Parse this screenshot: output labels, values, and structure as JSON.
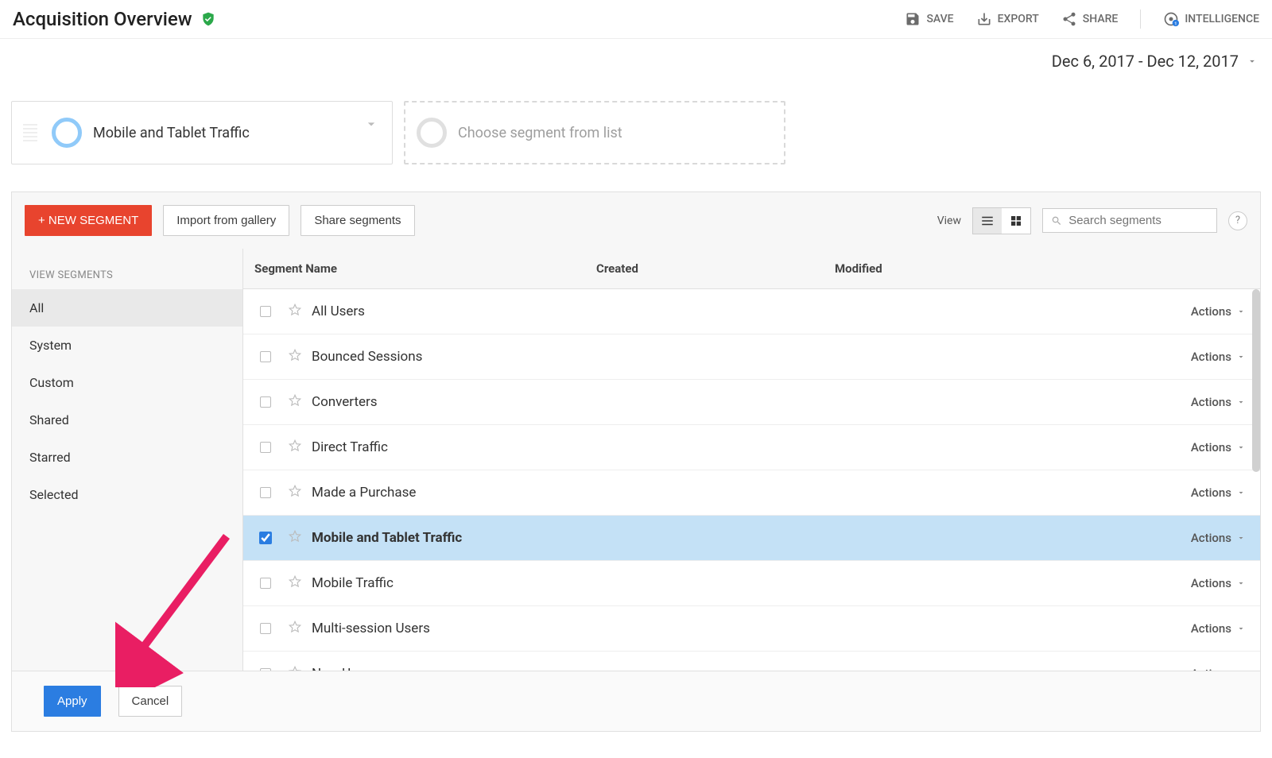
{
  "header": {
    "title": "Acquisition Overview",
    "actions": {
      "save": "Save",
      "export": "Export",
      "share": "Share",
      "intelligence": "Intelligence"
    }
  },
  "date_range": "Dec 6, 2017 - Dec 12, 2017",
  "segment_strip": {
    "selected_label": "Mobile and Tablet Traffic",
    "placeholder_label": "Choose segment from list"
  },
  "toolbar": {
    "new_segment": "+ New Segment",
    "import_gallery": "Import from gallery",
    "share_segments": "Share segments",
    "view_label": "View",
    "search_placeholder": "Search segments"
  },
  "sidebar": {
    "heading": "VIEW SEGMENTS",
    "items": [
      "All",
      "System",
      "Custom",
      "Shared",
      "Starred",
      "Selected"
    ],
    "active_index": 0
  },
  "table": {
    "columns": {
      "name": "Segment Name",
      "created": "Created",
      "modified": "Modified",
      "actions": "Actions"
    },
    "rows": [
      {
        "name": "All Users",
        "selected": false
      },
      {
        "name": "Bounced Sessions",
        "selected": false
      },
      {
        "name": "Converters",
        "selected": false
      },
      {
        "name": "Direct Traffic",
        "selected": false
      },
      {
        "name": "Made a Purchase",
        "selected": false
      },
      {
        "name": "Mobile and Tablet Traffic",
        "selected": true
      },
      {
        "name": "Mobile Traffic",
        "selected": false
      },
      {
        "name": "Multi-session Users",
        "selected": false
      },
      {
        "name": "New Users",
        "selected": false
      }
    ]
  },
  "footer": {
    "apply": "Apply",
    "cancel": "Cancel"
  }
}
